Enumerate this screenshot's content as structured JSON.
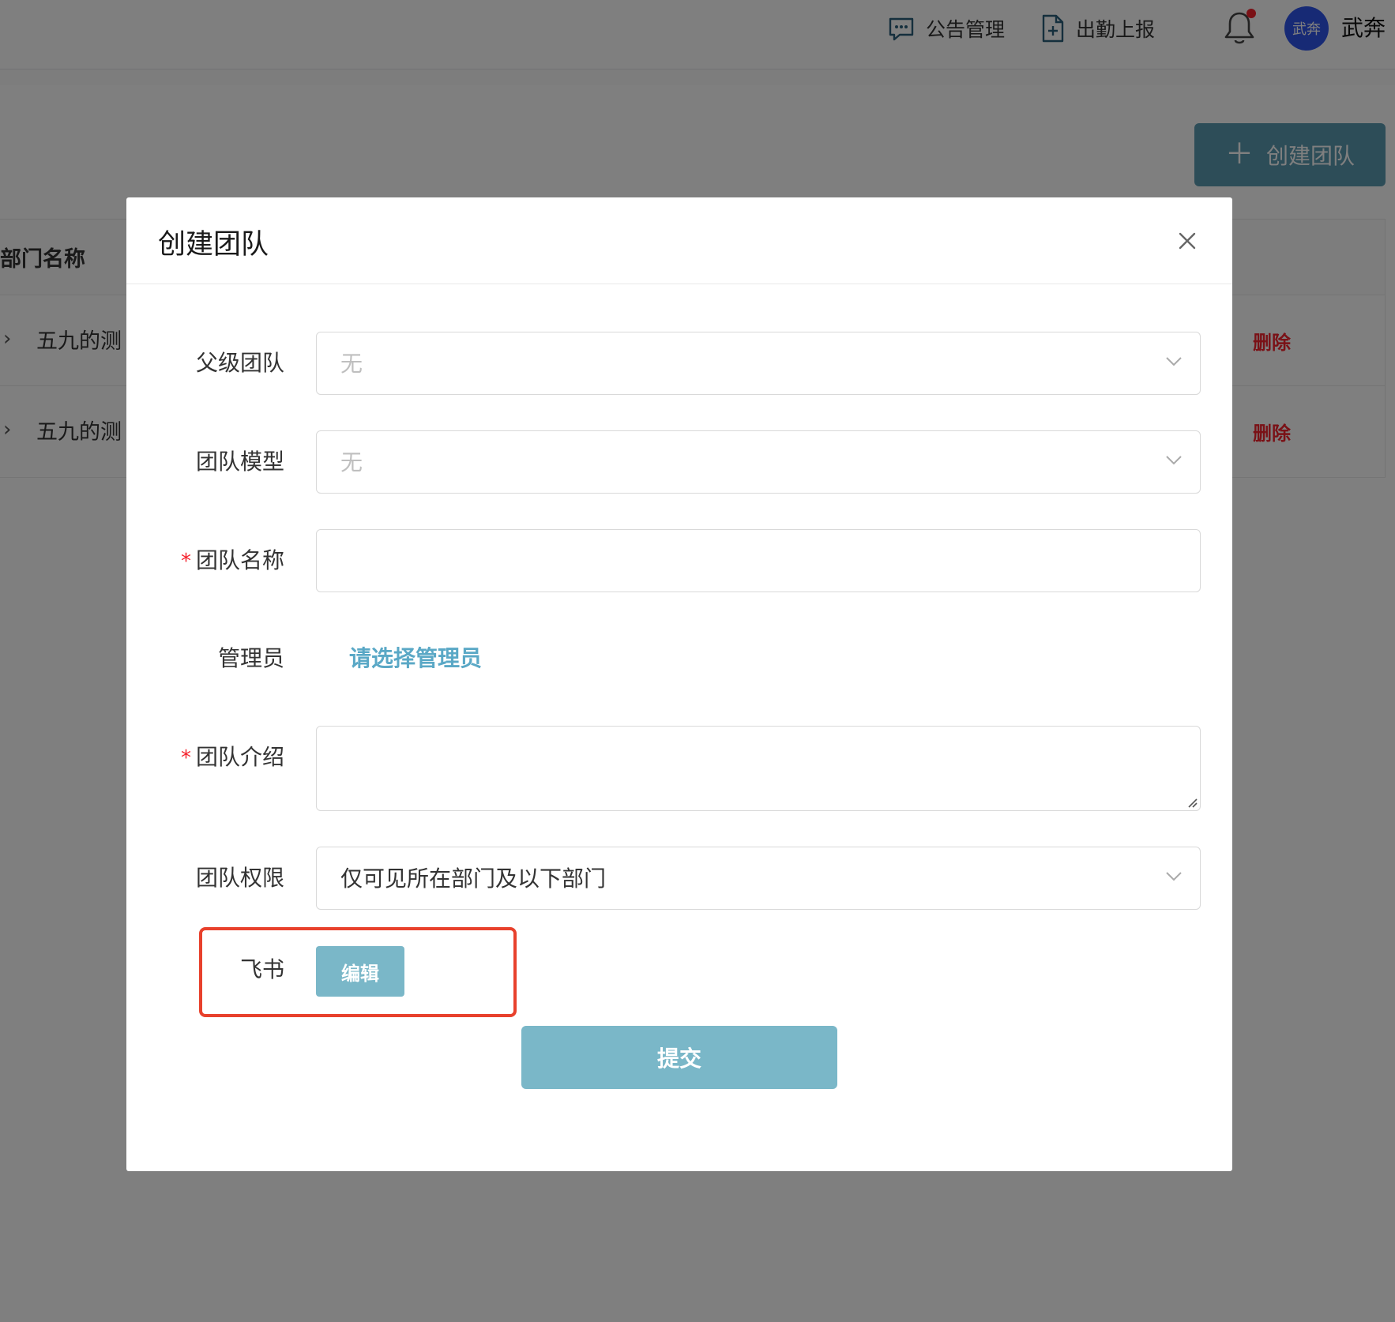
{
  "header": {
    "notice_label": "公告管理",
    "attendance_label": "出勤上报",
    "avatar_text": "武奔",
    "user_name": "武奔"
  },
  "toolbar": {
    "create_team_label": "创建团队",
    "create_icon": "plus-icon"
  },
  "table": {
    "column_dept_name": "部门名称",
    "rows": [
      {
        "name": "五九的测",
        "delete_label": "删除"
      },
      {
        "name": "五九的测",
        "delete_label": "删除"
      }
    ]
  },
  "modal": {
    "title": "创建团队",
    "fields": {
      "parent_team": {
        "label": "父级团队",
        "value": "无"
      },
      "team_model": {
        "label": "团队模型",
        "value": "无"
      },
      "team_name": {
        "label": "团队名称",
        "value": "",
        "required_mark": "*"
      },
      "admin": {
        "label": "管理员",
        "link_text": "请选择管理员"
      },
      "team_intro": {
        "label": "团队介绍",
        "value": "",
        "required_mark": "*"
      },
      "team_permission": {
        "label": "团队权限",
        "value": "仅可见所在部门及以下部门"
      },
      "feishu": {
        "label": "飞书",
        "button_label": "编辑"
      }
    },
    "submit_label": "提交"
  },
  "colors": {
    "accent": "#7ab7c8",
    "link": "#5aa8c6",
    "danger": "#f5222d",
    "highlight": "#e8412c",
    "avatar_bg": "#2f54eb"
  }
}
